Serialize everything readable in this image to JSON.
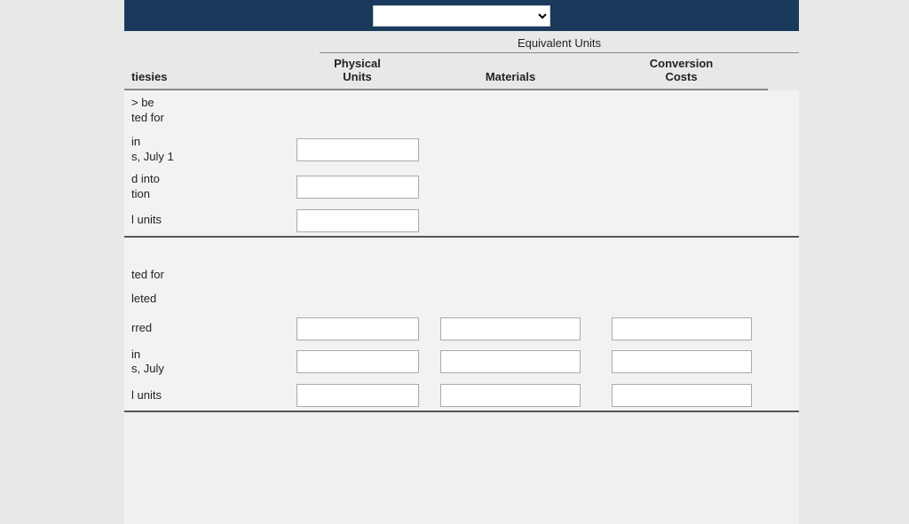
{
  "header": {
    "dropdown_placeholder": "",
    "equiv_units_label": "Equivalent Units"
  },
  "columns": {
    "activities_label": "ties",
    "physical_units_label": "Physical\nUnits",
    "physical_units_line1": "Physical",
    "physical_units_line2": "Units",
    "materials_label": "Materials",
    "conversion_costs_line1": "Conversion",
    "conversion_costs_line2": "Costs"
  },
  "section1": {
    "row1_label": "> be\nted for",
    "row1_line1": "> be",
    "row1_line2": "ted for",
    "row2_label_line1": "in",
    "row2_label_line2": "s, July 1",
    "row3_label_line1": "d into",
    "row3_label_line2": "tion",
    "row4_label": "l units"
  },
  "section2": {
    "section_header_line1": "ted for",
    "row1_label": "leted",
    "row2_label": "rred",
    "row3_label_line1": "in",
    "row3_label_line2": "s, July",
    "row4_label": "l units"
  }
}
